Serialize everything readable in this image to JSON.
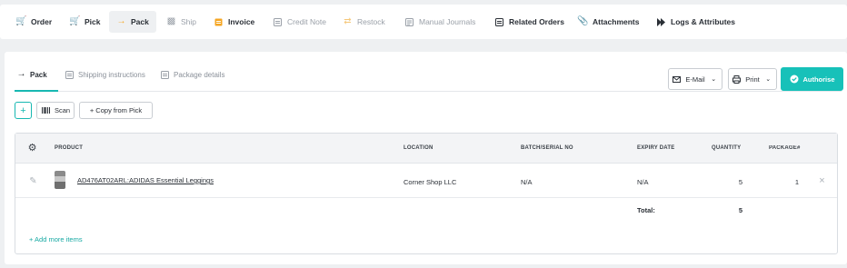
{
  "top_tabs": [
    {
      "label": "Order",
      "icon": "cart-icon",
      "state": "normal"
    },
    {
      "label": "Pick",
      "icon": "basket-icon",
      "state": "normal"
    },
    {
      "label": "Pack",
      "icon": "arrow-right-icon",
      "state": "active"
    },
    {
      "label": "Ship",
      "icon": "truck-icon",
      "state": "disabled"
    },
    {
      "label": "Invoice",
      "icon": "invoice-icon",
      "state": "normal"
    },
    {
      "label": "Credit Note",
      "icon": "credit-note-icon",
      "state": "disabled"
    },
    {
      "label": "Restock",
      "icon": "restock-icon",
      "state": "disabled"
    },
    {
      "label": "Manual Journals",
      "icon": "journal-icon",
      "state": "disabled"
    },
    {
      "label": "Related Orders",
      "icon": "related-orders-icon",
      "state": "normal"
    },
    {
      "label": "Attachments",
      "icon": "paperclip-icon",
      "state": "normal"
    },
    {
      "label": "Logs & Attributes",
      "icon": "logs-icon",
      "state": "normal"
    }
  ],
  "sub_tabs": [
    {
      "label": "Pack",
      "icon": "arrow-right-icon",
      "state": "active"
    },
    {
      "label": "Shipping instructions",
      "icon": "document-icon",
      "state": "disabled"
    },
    {
      "label": "Package details",
      "icon": "document-icon",
      "state": "disabled"
    }
  ],
  "actions": {
    "email_label": "E-Mail",
    "print_label": "Print",
    "authorise_label": "Authorise"
  },
  "toolbar": {
    "add_symbol": "+",
    "scan_label": "Scan",
    "copy_label": "+ Copy from Pick"
  },
  "table": {
    "headers": {
      "product": "PRODUCT",
      "location": "LOCATION",
      "batch": "BATCH/SERIAL NO",
      "expiry": "EXPIRY DATE",
      "quantity": "QUANTITY",
      "package": "PACKAGE#"
    },
    "rows": [
      {
        "product": "AD476AT02ARL:ADIDAS Essential Leggings",
        "location": "Corner Shop LLC",
        "batch": "N/A",
        "expiry": "N/A",
        "quantity": "5",
        "package": "1"
      }
    ],
    "total_label": "Total:",
    "total_quantity": "5",
    "add_more_label": "+ Add more items"
  },
  "colors": {
    "accent": "#17c1b9",
    "active_tab_arrow": "#f5a623",
    "cart_green": "#5cb85c"
  }
}
